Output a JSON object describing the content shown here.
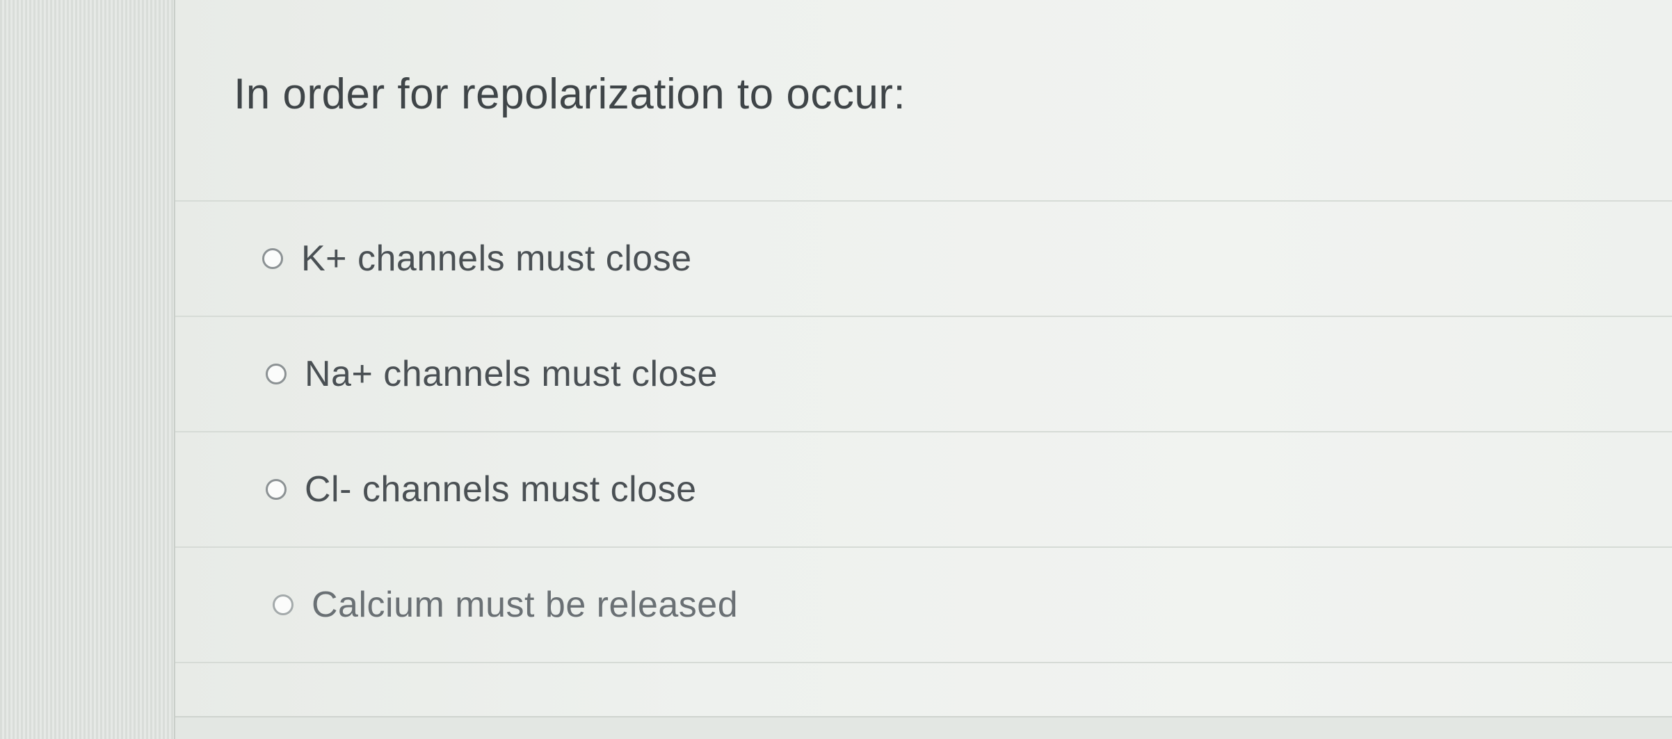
{
  "question": {
    "prompt": "In order for repolarization to occur:",
    "options": [
      {
        "label": "K+ channels must close",
        "selected": false
      },
      {
        "label": "Na+ channels must close",
        "selected": false
      },
      {
        "label": "Cl- channels must close",
        "selected": false
      },
      {
        "label": "Calcium must be released",
        "selected": false
      }
    ]
  },
  "colors": {
    "text": "#3f4548",
    "radio_border": "#8c9294",
    "divider": "#d6dbd6"
  }
}
